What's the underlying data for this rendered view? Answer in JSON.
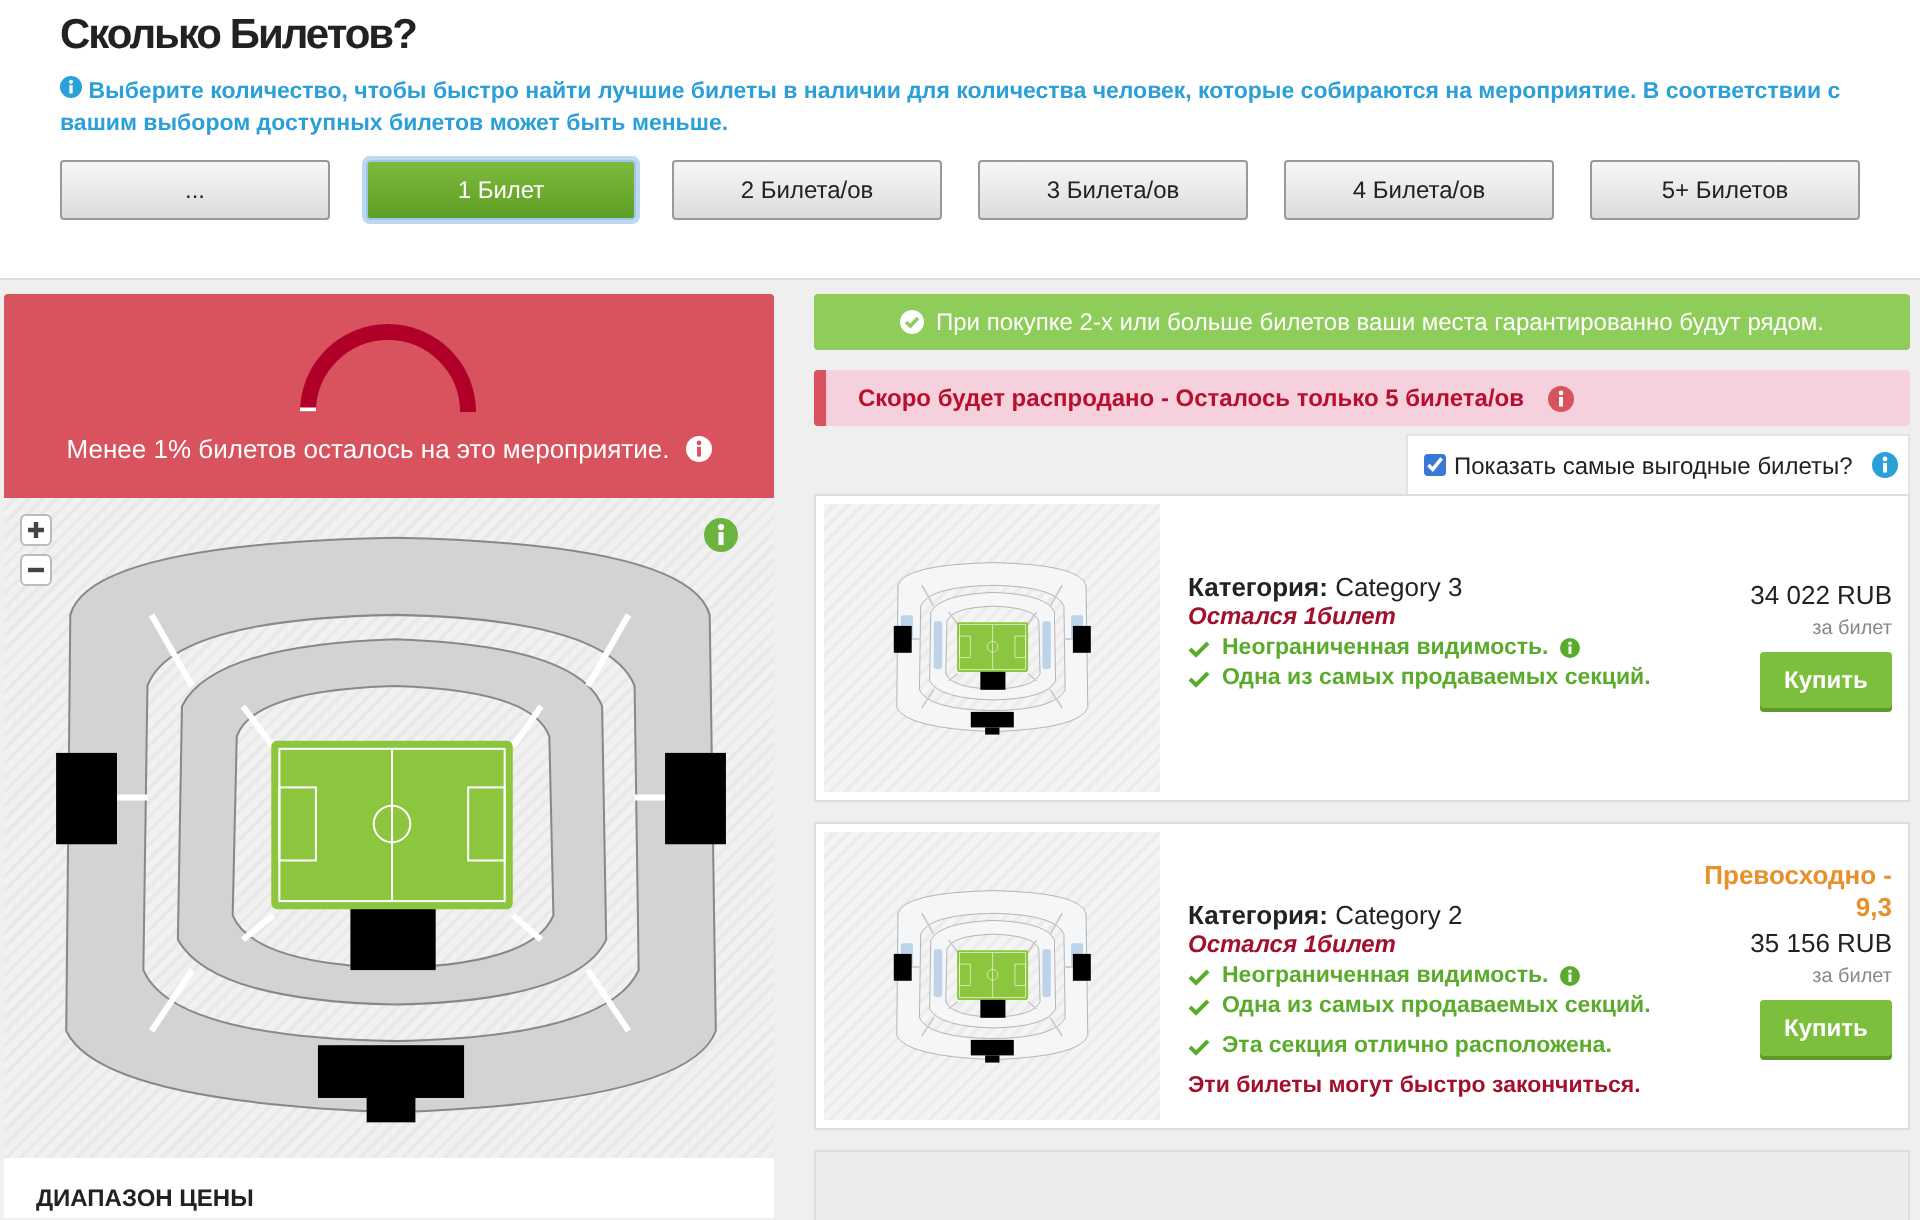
{
  "header": {
    "title": "Сколько Билетов?",
    "info": "Выберите количество, чтобы быстро найти лучшие билеты в наличии для количества человек, которые собираются на мероприятие. В соответствии с вашим выбором доступных билетов может быть меньше."
  },
  "quantity_options": [
    {
      "label": "...",
      "selected": false
    },
    {
      "label": "1 Билет",
      "selected": true
    },
    {
      "label": "2 Билета/ов",
      "selected": false
    },
    {
      "label": "3 Билета/ов",
      "selected": false
    },
    {
      "label": "4 Билета/ов",
      "selected": false
    },
    {
      "label": "5+ Билетов",
      "selected": false
    }
  ],
  "availability": {
    "message": "Менее 1% билетов осталось на это мероприятие."
  },
  "price_range": {
    "title": "ДИАПАЗОН ЦЕНЫ"
  },
  "notices": [
    {
      "kind": "success",
      "text": "При покупке 2-х или больше билетов ваши места гарантированно будут рядом."
    },
    {
      "kind": "alert",
      "text": "Скоро будет распродано - Осталось только 5 билета/ов"
    }
  ],
  "best_tickets": {
    "label": "Показать самые выгодные билеты?",
    "checked": true
  },
  "tickets": [
    {
      "category_label": "Категория:",
      "category": "Category 3",
      "remaining": "Остался 1билет",
      "features": [
        {
          "kind": "check",
          "text": "Неограниченная видимость.",
          "info": true
        },
        {
          "kind": "check",
          "text": "Одна из самых продаваемых секций.",
          "info": false
        }
      ],
      "price": "34 022 RUB",
      "per": "за билет",
      "buy": "Купить"
    },
    {
      "category_label": "Категория:",
      "category": "Category 2",
      "remaining": "Остался 1билет",
      "features": [
        {
          "kind": "check",
          "text": "Неограниченная видимость.",
          "info": true
        },
        {
          "kind": "check",
          "text": "Одна из самых продаваемых секций.",
          "info": false
        },
        {
          "kind": "check",
          "text": "Эта секция отлично расположена.",
          "info": false
        },
        {
          "kind": "warning",
          "text": "Эти билеты могут быстро закончиться.",
          "info": false
        }
      ],
      "rating": "Превосходно - 9,3",
      "price": "35 156 RUB",
      "per": "за билет",
      "buy": "Купить"
    }
  ]
}
